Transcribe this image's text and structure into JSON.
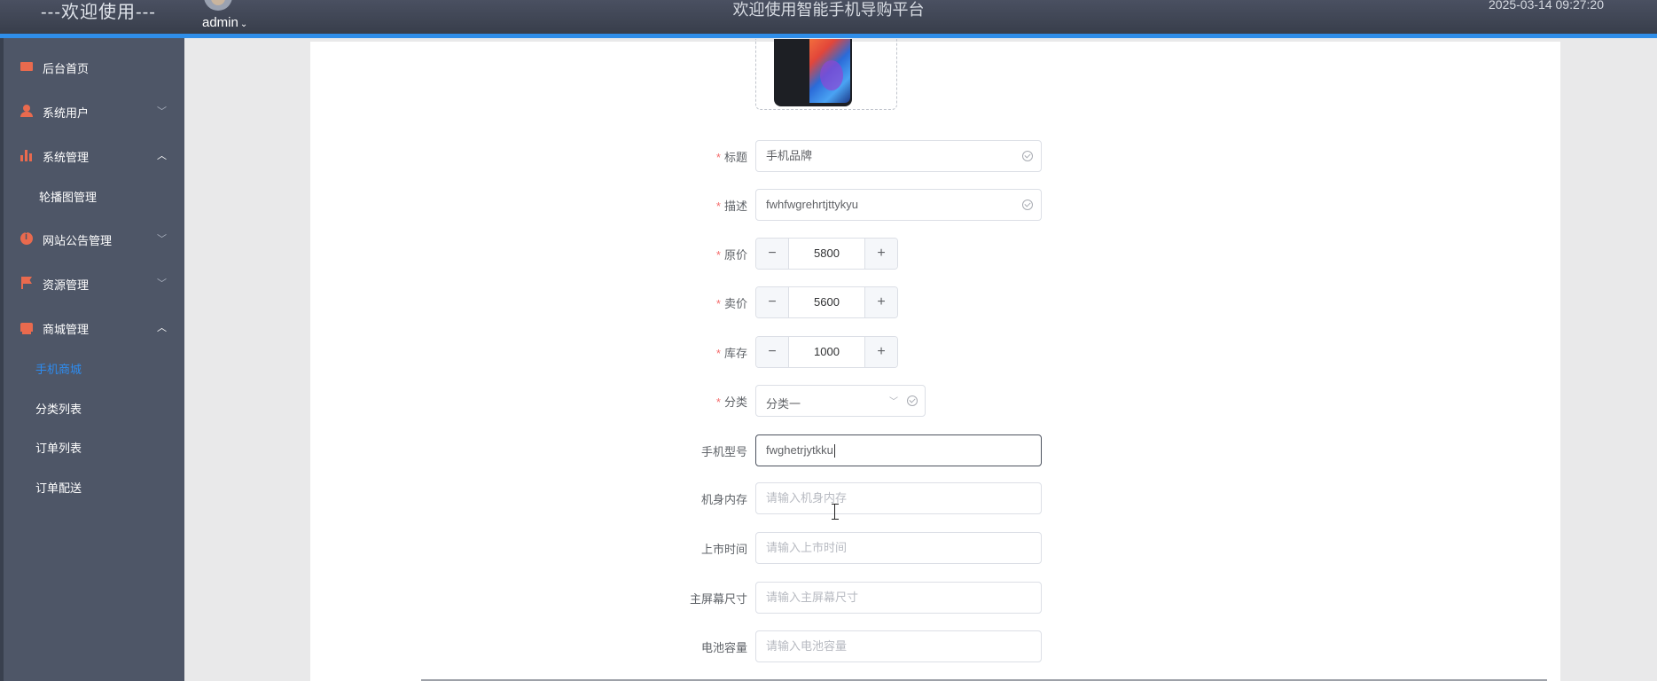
{
  "header": {
    "brand": "---欢迎使用---",
    "user": "admin",
    "site_title": "欢迎使用智能手机导购平台",
    "datetime": "2025-03-14 09:27:20"
  },
  "sidebar": {
    "items": [
      {
        "label": "后台首页",
        "icon": "monitor-icon"
      },
      {
        "label": "系统用户",
        "icon": "user-icon",
        "expanded": false
      },
      {
        "label": "系统管理",
        "icon": "bar-chart-icon",
        "expanded": true
      },
      {
        "label": "轮播图管理"
      },
      {
        "label": "网站公告管理",
        "icon": "info-icon",
        "expanded": false
      },
      {
        "label": "资源管理",
        "icon": "flag-icon",
        "expanded": false
      },
      {
        "label": "商城管理",
        "icon": "shop-icon",
        "expanded": true
      },
      {
        "label": "手机商城",
        "active": true
      },
      {
        "label": "分类列表"
      },
      {
        "label": "订单列表"
      },
      {
        "label": "订单配送"
      }
    ]
  },
  "form": {
    "title_label": "标题",
    "title_value": "手机品牌",
    "desc_label": "描述",
    "desc_value": "fwhfwgrehrtjttykyu",
    "orig_price_label": "原价",
    "orig_price_value": "5800",
    "sell_price_label": "卖价",
    "sell_price_value": "5600",
    "stock_label": "库存",
    "stock_value": "1000",
    "category_label": "分类",
    "category_value": "分类一",
    "model_label": "手机型号",
    "model_value": "fwghetrjytkku",
    "memory_label": "机身内存",
    "memory_placeholder": "请输入机身内存",
    "release_label": "上市时间",
    "release_placeholder": "请输入上市时间",
    "screen_label": "主屏幕尺寸",
    "screen_placeholder": "请输入主屏幕尺寸",
    "battery_label": "电池容量",
    "battery_placeholder": "请输入电池容量",
    "stepper_minus": "−",
    "stepper_plus": "+"
  },
  "colors": {
    "header": "#3b4252",
    "accent": "#2f8ee9",
    "sidebar": "#4e5667",
    "icon": "#e96a4e",
    "active_menu": "#2e8cf0",
    "required": "#f56c6c"
  }
}
